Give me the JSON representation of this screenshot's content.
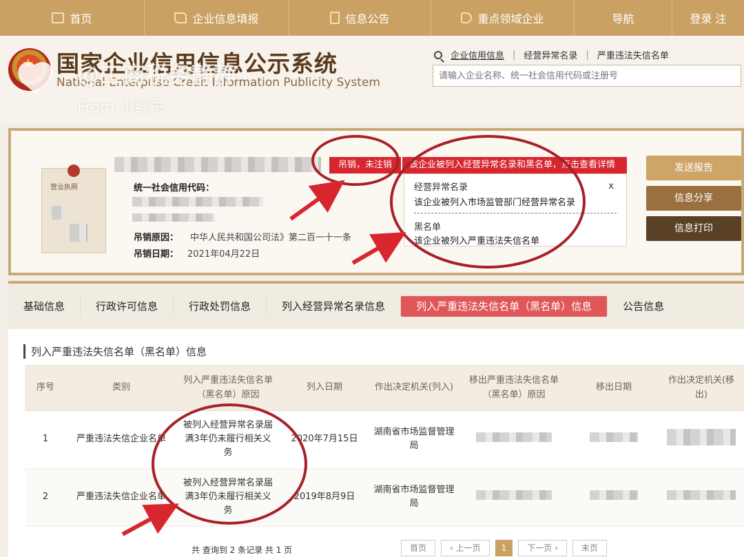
{
  "topnav": {
    "items": [
      {
        "label": "首页",
        "icon": "monitor-icon"
      },
      {
        "label": "企业信息填报",
        "icon": "pen-icon"
      },
      {
        "label": "信息公告",
        "icon": "document-icon"
      },
      {
        "label": "重点领域企业",
        "icon": "speaker-icon"
      },
      {
        "label": "导航",
        "icon": ""
      },
      {
        "label": "登录  注",
        "icon": ""
      }
    ]
  },
  "header": {
    "title": "国家企业信用信息公示系统",
    "subtitle": "National Enterprise Credit Information Publicity System",
    "search_links": [
      "企业信用信息",
      "经营异常名录",
      "严重违法失信名单"
    ],
    "search_placeholder": "请输入企业名称、统一社会信用代码或注册号"
  },
  "watermark": {
    "handle": "@工商税务静静",
    "from": "From 小红书"
  },
  "company": {
    "license_label": "营业执照",
    "status_badge": "吊销，未注销",
    "alert_text": "该企业被列入经营异常名录和黑名单，点击查看详情",
    "popup": {
      "close": "x",
      "abnormal_title": "经营异常名录",
      "abnormal_desc": "该企业被列入市场监管部门经营异常名录",
      "blacklist_title": "黑名单",
      "blacklist_desc": "该企业被列入严重违法失信名单"
    },
    "credit_code_label": "统一社会信用代码：",
    "revoke_reason_label": "吊销原因：",
    "revoke_reason": "中华人民共和国公司法》第二百一十一条",
    "revoke_date_label": "吊销日期：",
    "revoke_date": "2021年04月22日",
    "buttons": {
      "send_report": "发送报告",
      "share": "信息分享",
      "print": "信息打印"
    },
    "colors": {
      "status_red": "#d7262e",
      "gold": "#c9a263",
      "annotation": "#a8202a"
    }
  },
  "tabs": [
    "基础信息",
    "行政许可信息",
    "行政处罚信息",
    "列入经营异常名录信息",
    "列入严重违法失信名单（黑名单）信息",
    "公告信息"
  ],
  "active_tab": 4,
  "section_title": "列入严重违法失信名单（黑名单）信息",
  "table": {
    "headers": [
      "序号",
      "类别",
      "列入严重违法失信名单（黑名单）原因",
      "列入日期",
      "作出决定机关(列入)",
      "移出严重违法失信名单（黑名单）原因",
      "移出日期",
      "作出决定机关(移出)"
    ],
    "rows": [
      [
        "1",
        "严重违法失信企业名单",
        "被列入经营异常名录届满3年仍未履行相关义务",
        "2020年7月15日",
        "湖南省市场监督管理局",
        "",
        "",
        ""
      ],
      [
        "2",
        "严重违法失信企业名单",
        "被列入经营异常名录届满3年仍未履行相关义务",
        "2019年8月9日",
        "湖南省市场监督管理局",
        "",
        "",
        ""
      ]
    ]
  },
  "pagination": {
    "summary": "共 查询到 2 条记录 共 1 页",
    "first": "首页",
    "prev": "‹ 上一页",
    "current": "1",
    "next": "下一页 ›",
    "last": "末页"
  }
}
